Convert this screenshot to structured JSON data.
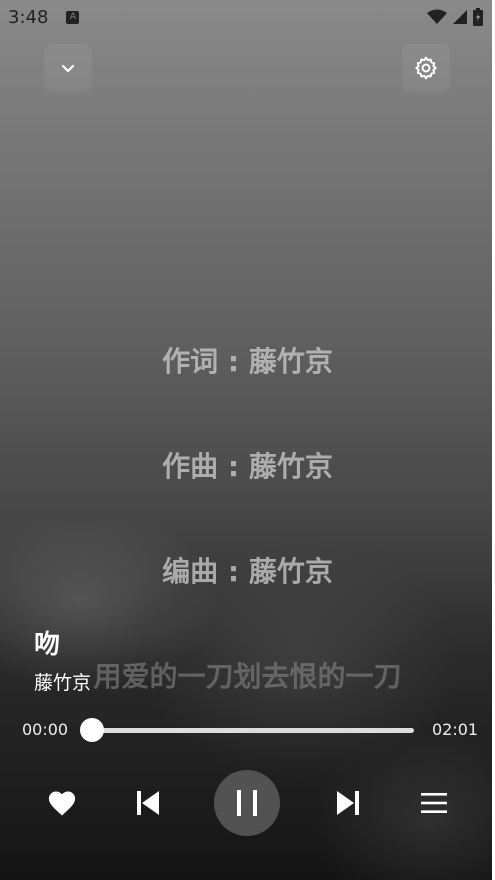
{
  "status_bar": {
    "time": "3:48",
    "notification_icon_letter": "A"
  },
  "controls_top": {
    "collapse_icon": "chevron-down-icon",
    "settings_icon": "gear-icon"
  },
  "lyrics": [
    "作词 : 藤竹京",
    "作曲 : 藤竹京",
    "编曲 : 藤竹京",
    "用爱的一刀划去恨的一刀"
  ],
  "song": {
    "title": "吻",
    "artist": "藤竹京"
  },
  "playback": {
    "current_time": "00:00",
    "total_time": "02:01",
    "progress": 0.0
  },
  "player_controls": {
    "like_icon": "heart-icon",
    "previous_icon": "skip-previous-icon",
    "play_pause_icon": "pause-icon",
    "next_icon": "skip-next-icon",
    "playlist_icon": "menu-icon"
  }
}
